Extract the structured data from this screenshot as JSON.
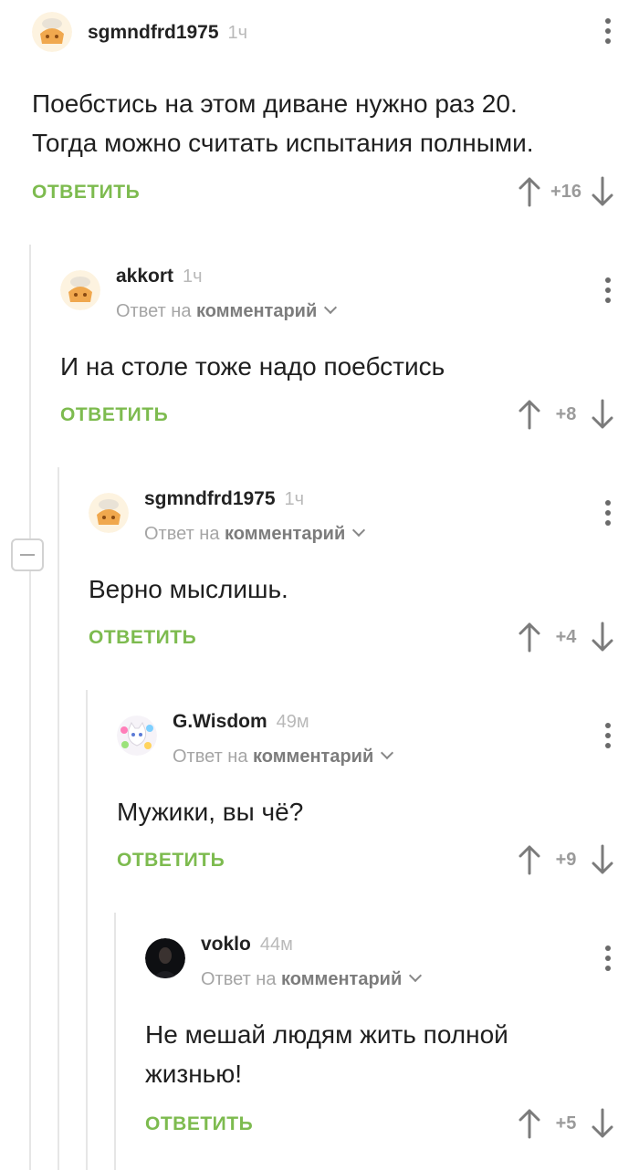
{
  "comments": [
    {
      "username": "sgmndfrd1975",
      "time": "1ч",
      "reply_prefix": "",
      "reply_link": "",
      "text_lines": [
        "Поебстись на этом диване нужно раз 20.",
        "Тогда можно считать испытания полными."
      ],
      "reply_label": "ОТВЕТИТЬ",
      "score": "+16",
      "avatar": "chef-avatar-icon"
    },
    {
      "username": "akkort",
      "time": "1ч",
      "reply_prefix": "Ответ на",
      "reply_link": "комментарий",
      "text_lines": [
        "И на столе тоже надо поебстись"
      ],
      "reply_label": "ОТВЕТИТЬ",
      "score": "+8",
      "avatar": "chef-avatar-icon"
    },
    {
      "username": "sgmndfrd1975",
      "time": "1ч",
      "reply_prefix": "Ответ на",
      "reply_link": "комментарий",
      "text_lines": [
        "Верно мыслишь."
      ],
      "reply_label": "ОТВЕТИТЬ",
      "score": "+4",
      "avatar": "chef-avatar-icon"
    },
    {
      "username": "G.Wisdom",
      "time": "49м",
      "reply_prefix": "Ответ на",
      "reply_link": "комментарий",
      "text_lines": [
        "Мужики, вы чё?"
      ],
      "reply_label": "ОТВЕТИТЬ",
      "score": "+9",
      "avatar": "kitten-avatar-icon"
    },
    {
      "username": "voklo",
      "time": "44м",
      "reply_prefix": "Ответ на",
      "reply_link": "комментарий",
      "text_lines": [
        "Не мешай людям жить полной",
        "жизнью!"
      ],
      "reply_label": "ОТВЕТИТЬ",
      "score": "+5",
      "avatar": "photo-avatar-icon"
    }
  ],
  "colors": {
    "accent_green": "#7dbb4f",
    "thread_line": "#e6e6e6",
    "muted_text": "#a5a5a5"
  }
}
